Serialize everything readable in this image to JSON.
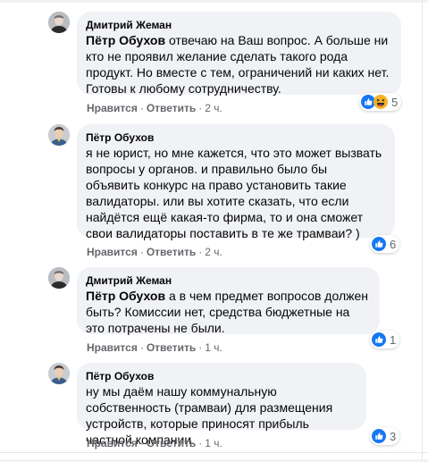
{
  "actions": {
    "like": "Нравится",
    "reply": "Ответить",
    "separator": "·"
  },
  "colors": {
    "bubble": "#f0f2f5",
    "secondary_text": "#65676b",
    "like_blue": "#1877f2",
    "haha_yellow": "#f7b125"
  },
  "comments": [
    {
      "author": "Дмитрий Жеман",
      "mention": "Пётр Обухов",
      "text": " отвечаю на Ваш вопрос. А больше ни кто не проявил желание сделать такого рода продукт. Но вместе с тем, ограничений ни каких нет. Готовы к любому сотрудничеству.",
      "time": "2 ч.",
      "reaction_icons": [
        "like-icon",
        "haha-icon"
      ],
      "reaction_count": "5"
    },
    {
      "author": "Пётр Обухов",
      "mention": "",
      "text": "я не юрист, но мне кажется, что это может вызвать вопросы у органов. и правильно было бы объявить конкурс на право установить такие валидаторы. или вы хотите сказать, что если найдётся ещё какая-то фирма, то и она сможет свои валидаторы поставить в те же трамваи? )",
      "time": "2 ч.",
      "reaction_icons": [
        "like-icon"
      ],
      "reaction_count": "6"
    },
    {
      "author": "Дмитрий Жеман",
      "mention": "Пётр Обухов",
      "text": " а в чем предмет вопросов должен быть? Комиссии нет, средства бюджетные на это потрачены не были.",
      "time": "1 ч.",
      "reaction_icons": [
        "like-icon"
      ],
      "reaction_count": "1"
    },
    {
      "author": "Пётр Обухов",
      "mention": "",
      "text": "ну мы даём нашу коммунальную собственность (трамваи) для размещения устройств, которые приносят прибыль частной компании.",
      "time": "1 ч.",
      "reaction_icons": [
        "like-icon"
      ],
      "reaction_count": "3"
    }
  ]
}
